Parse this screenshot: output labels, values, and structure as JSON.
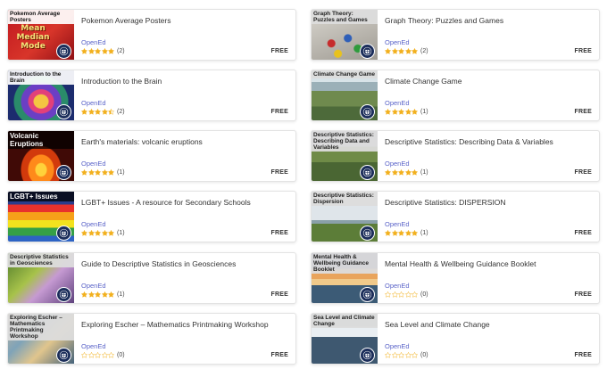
{
  "resources": [
    {
      "title": "Pokemon Average Posters",
      "provider": "OpenEd",
      "rating": 5,
      "reviews": "(2)",
      "price": "FREE",
      "thumb_label": "Pokemon Average Posters",
      "thumb_words": [
        "Mean",
        "Median",
        "Mode"
      ],
      "thumb_theme": "pokemon"
    },
    {
      "title": "Graph Theory: Puzzles and Games",
      "provider": "OpenEd",
      "rating": 5,
      "reviews": "(2)",
      "price": "FREE",
      "thumb_label": "Graph Theory: Puzzles and Games",
      "thumb_theme": "graph"
    },
    {
      "title": "Introduction to the Brain",
      "provider": "OpenEd",
      "rating": 4.5,
      "reviews": "(2)",
      "price": "FREE",
      "thumb_label": "Introduction to the Brain",
      "thumb_theme": "brain"
    },
    {
      "title": "Climate Change Game",
      "provider": "OpenEd",
      "rating": 5,
      "reviews": "(1)",
      "price": "FREE",
      "thumb_label": "Climate Change Game",
      "thumb_theme": "climate"
    },
    {
      "title": "Earth's materials: volcanic eruptions",
      "provider": "OpenEd",
      "rating": 5,
      "reviews": "(1)",
      "price": "FREE",
      "thumb_label": "Volcanic Eruptions",
      "thumb_theme": "volcano"
    },
    {
      "title": "Descriptive Statistics: Describing Data & Variables",
      "provider": "OpenEd",
      "rating": 5,
      "reviews": "(1)",
      "price": "FREE",
      "thumb_label": "Descriptive Statistics: Describing Data and Variables",
      "thumb_theme": "landscape"
    },
    {
      "title": "LGBT+ Issues - A resource for Secondary Schools",
      "provider": "OpenEd",
      "rating": 5,
      "reviews": "(1)",
      "price": "FREE",
      "thumb_label": "LGBT+ Issues",
      "thumb_theme": "lgbt"
    },
    {
      "title": "Descriptive Statistics: DISPERSION",
      "provider": "OpenEd",
      "rating": 5,
      "reviews": "(1)",
      "price": "FREE",
      "thumb_label": "Descriptive Statistics: Dispersion",
      "thumb_theme": "dispersion"
    },
    {
      "title": "Guide to Descriptive Statistics in Geosciences",
      "provider": "OpenEd",
      "rating": 5,
      "reviews": "(1)",
      "price": "FREE",
      "thumb_label": "Descriptive Statistics in Geosciences",
      "thumb_theme": "geo"
    },
    {
      "title": "Mental Health & Wellbeing Guidance Booklet",
      "provider": "OpenEd",
      "rating": 0,
      "reviews": "(0)",
      "price": "FREE",
      "thumb_label": "Mental Health & Wellbeing Guidance Booklet",
      "thumb_theme": "sunset"
    },
    {
      "title": "Exploring Escher – Mathematics Printmaking Workshop",
      "provider": "OpenEd",
      "rating": 0,
      "reviews": "(0)",
      "price": "FREE",
      "thumb_label": "Exploring Escher – Mathematics Printmaking Workshop",
      "thumb_theme": "escher"
    },
    {
      "title": "Sea Level and Climate Change",
      "provider": "OpenEd",
      "rating": 0,
      "reviews": "(0)",
      "price": "FREE",
      "thumb_label": "Sea Level and Climate Change",
      "thumb_theme": "sea"
    }
  ],
  "colors": {
    "star_filled": "#f2b01e",
    "star_empty": "#c9c9c9",
    "provider": "#5a63c8",
    "seal": "#1b2d5a"
  },
  "icons": {
    "rating": "star-icon",
    "institution": "university-seal-icon"
  }
}
